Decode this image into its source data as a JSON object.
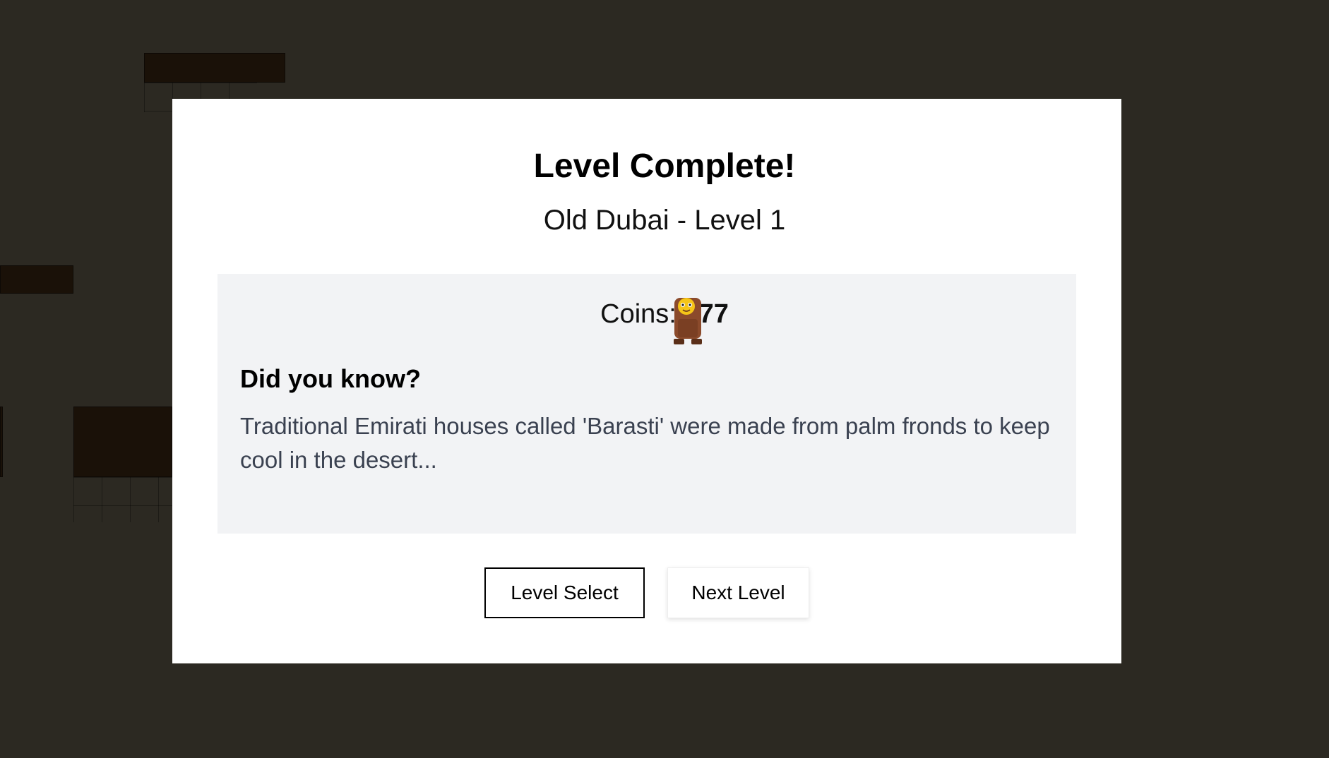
{
  "modal": {
    "title": "Level Complete!",
    "subtitle": "Old Dubai - Level 1",
    "coins_label": "Coins:",
    "coins_value": "777",
    "fact_heading": "Did you know?",
    "fact_text": "Traditional Emirati houses called 'Barasti' were made from palm fronds to keep cool in the desert...",
    "mascot_icon": "monkey-icon"
  },
  "buttons": {
    "level_select": "Level Select",
    "next_level": "Next Level"
  },
  "colors": {
    "overlay_background": "#2c2922",
    "modal_background": "#ffffff",
    "info_box_background": "#f2f3f5",
    "fact_text_color": "#3a4150"
  }
}
